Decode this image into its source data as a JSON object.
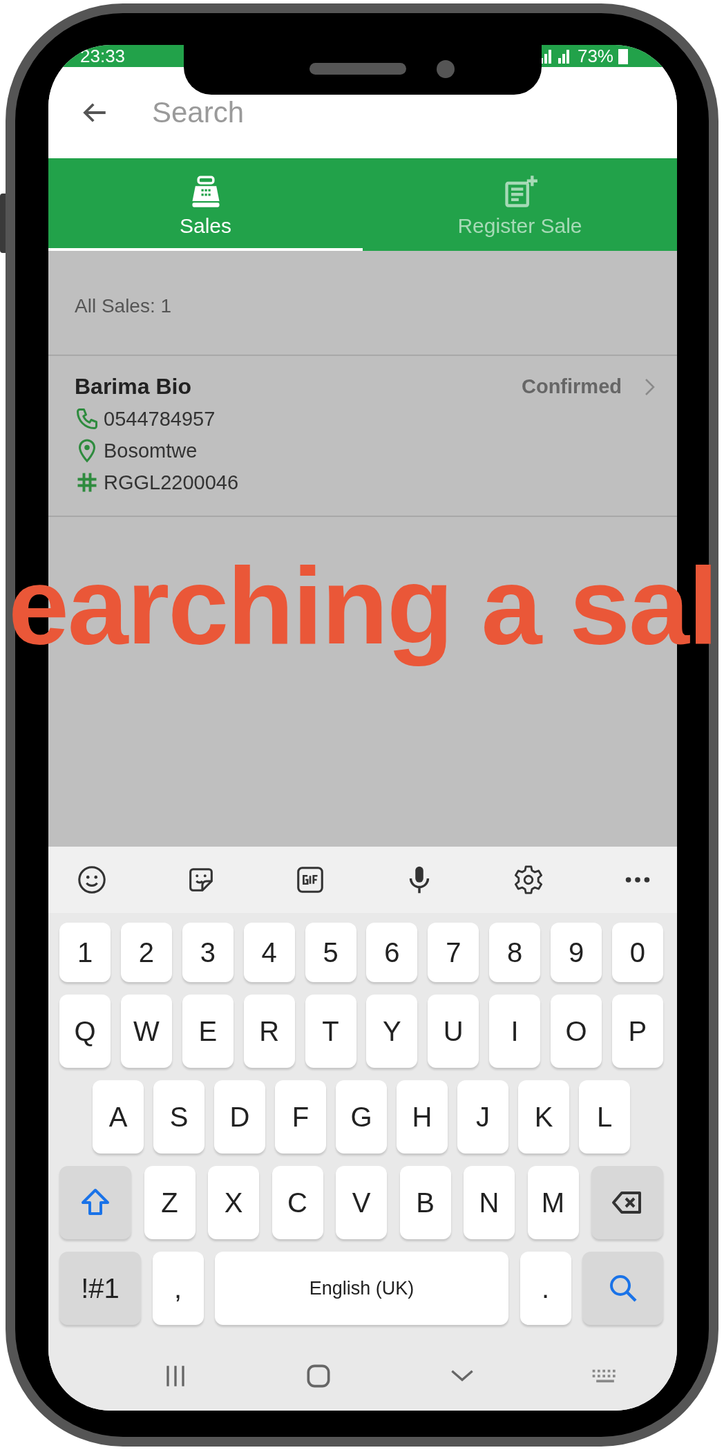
{
  "status_bar": {
    "time": "23:33",
    "battery": "73%"
  },
  "search": {
    "placeholder": "Search"
  },
  "tabs": [
    {
      "label": "Sales",
      "selected": true
    },
    {
      "label": "Register Sale",
      "selected": false
    }
  ],
  "summary": "All Sales: 1",
  "sales": [
    {
      "name": "Barima Bio",
      "status": "Confirmed",
      "phone": "0544784957",
      "location": "Bosomtwe",
      "reference": "RGGL2200046"
    }
  ],
  "caption": "earching a sal",
  "keyboard": {
    "rows": [
      [
        {
          "kind": "char",
          "label": "1"
        },
        {
          "kind": "char",
          "label": "2"
        },
        {
          "kind": "char",
          "label": "3"
        },
        {
          "kind": "char",
          "label": "4"
        },
        {
          "kind": "char",
          "label": "5"
        },
        {
          "kind": "char",
          "label": "6"
        },
        {
          "kind": "char",
          "label": "7"
        },
        {
          "kind": "char",
          "label": "8"
        },
        {
          "kind": "char",
          "label": "9"
        },
        {
          "kind": "char",
          "label": "0"
        }
      ],
      [
        {
          "kind": "char",
          "label": "Q"
        },
        {
          "kind": "char",
          "label": "W"
        },
        {
          "kind": "char",
          "label": "E"
        },
        {
          "kind": "char",
          "label": "R"
        },
        {
          "kind": "char",
          "label": "T"
        },
        {
          "kind": "char",
          "label": "Y"
        },
        {
          "kind": "char",
          "label": "U"
        },
        {
          "kind": "char",
          "label": "I"
        },
        {
          "kind": "char",
          "label": "O"
        },
        {
          "kind": "char",
          "label": "P"
        }
      ],
      [
        {
          "kind": "char",
          "label": "A"
        },
        {
          "kind": "char",
          "label": "S"
        },
        {
          "kind": "char",
          "label": "D"
        },
        {
          "kind": "char",
          "label": "F"
        },
        {
          "kind": "char",
          "label": "G"
        },
        {
          "kind": "char",
          "label": "H"
        },
        {
          "kind": "char",
          "label": "J"
        },
        {
          "kind": "char",
          "label": "K"
        },
        {
          "kind": "char",
          "label": "L"
        }
      ],
      [
        {
          "kind": "shift"
        },
        {
          "kind": "char",
          "label": "Z"
        },
        {
          "kind": "char",
          "label": "X"
        },
        {
          "kind": "char",
          "label": "C"
        },
        {
          "kind": "char",
          "label": "V"
        },
        {
          "kind": "char",
          "label": "B"
        },
        {
          "kind": "char",
          "label": "N"
        },
        {
          "kind": "char",
          "label": "M"
        },
        {
          "kind": "backspace"
        }
      ]
    ],
    "bottom_row": {
      "symbols": "!#1",
      "comma": ",",
      "space": "English (UK)",
      "period": "."
    }
  }
}
